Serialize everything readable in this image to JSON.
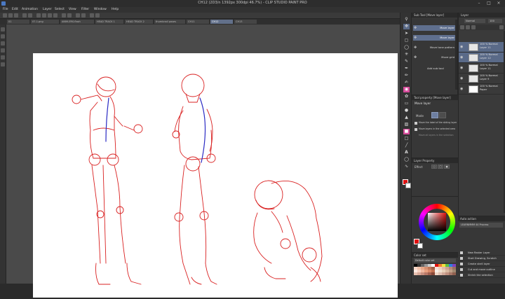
{
  "window": {
    "title": "CH12 (2D3/n 1392px 300dpi 46.7%) - CLIP STUDIO PAINT PRO"
  },
  "menu": [
    "File",
    "Edit",
    "Animation",
    "Layer",
    "Select",
    "View",
    "Filter",
    "Window",
    "Help"
  ],
  "tabs": [
    {
      "label": "01",
      "active": false
    },
    {
      "label": "07-1.png",
      "active": false
    },
    {
      "label": "ANIM-ERS.flash",
      "active": false
    },
    {
      "label": "HEAD TRACK 1",
      "active": false
    },
    {
      "label": "HEAD TRACK 2",
      "active": false
    },
    {
      "label": "thumbnail poses",
      "active": false
    },
    {
      "label": "CH11",
      "active": false
    },
    {
      "label": "CH12",
      "active": true
    },
    {
      "label": "CH13",
      "active": false
    }
  ],
  "subtool": {
    "header": "Sub Tool [Move layer]",
    "items": [
      "Move layer",
      "Move layer",
      "Move tone pattern",
      "Move grid",
      "Add sub tool"
    ]
  },
  "tool_property": {
    "header": "Tool property [Move layer]",
    "title": "Move layer",
    "mode_label": "Mode",
    "options": [
      "Move the label of the sliding layer",
      "Move layers in the selected area",
      "Move all layers in the selection"
    ]
  },
  "layer_property": {
    "header": "Layer Property",
    "effect_label": "Effect"
  },
  "colors": {
    "main": "#e01010",
    "sub": "#ffffff",
    "accent": "#5f6f8e",
    "magenta": "#d64b9b"
  },
  "layers": {
    "header": "Layer",
    "blend_mode": "Normal",
    "opacity": "100",
    "items": [
      {
        "name": "100 % Normal",
        "sub": "Layer 11",
        "selected": true
      },
      {
        "name": "100 % Normal",
        "sub": "Layer 12",
        "selected": true
      },
      {
        "name": "100 % Normal",
        "sub": "Layer 11",
        "selected": false
      },
      {
        "name": "100 % Normal",
        "sub": "Layer 9",
        "selected": false
      },
      {
        "name": "100 % Normal",
        "sub": "Paper",
        "selected": false
      }
    ]
  },
  "auto_actions": {
    "header": "Auto action",
    "set": "LEARNMMM 44 Process",
    "items": [
      "New Raster Layer",
      "Start Drawing, Scratch",
      "Create shell layer",
      "Cut and move outline",
      "Shrink the selection"
    ]
  },
  "color_set": {
    "header": "Color set",
    "set_name": "Default color set"
  }
}
